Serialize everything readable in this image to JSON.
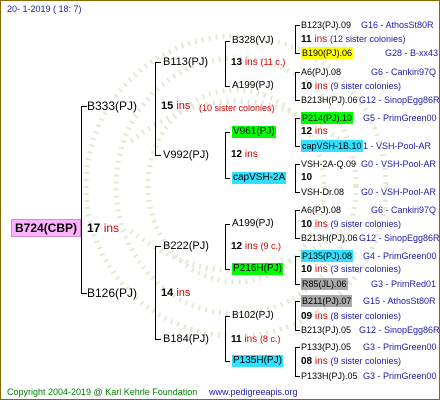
{
  "header": {
    "date": "20-   1-2019 ( 18:   7)"
  },
  "footer": {
    "copyright": "Copyright 2004-2019 @ Karl Kehrle Foundation",
    "site": "www.pedigreeapis.org"
  },
  "colors": {
    "pink": "#ffb0ff",
    "yellow": "#ffff00",
    "lime": "#00ff00",
    "cyan": "#2fe0ff",
    "grey": "#a9a9a9",
    "text_red": "#d40000",
    "text_navy": "#1a1aa8",
    "text_green": "#008000"
  },
  "tree": {
    "root": {
      "name": "B724(CBP)",
      "ins": "17",
      "ins_label": "ins"
    },
    "g1": [
      {
        "name": "B333(PJ)",
        "ins": "15",
        "ins_label": "ins",
        "note": "(10 sister colonies)"
      },
      {
        "name": "B126(PJ)",
        "ins": "14",
        "ins_label": "ins"
      }
    ],
    "g2": [
      {
        "name": "B113(PJ)",
        "ins": "13",
        "ins_label": "ins",
        "note": "(11 c.)"
      },
      {
        "name": "V992(PJ)",
        "ins": "12",
        "ins_label": "ins"
      },
      {
        "name": "B222(PJ)",
        "ins": "12",
        "ins_label": "ins",
        "note": "(9 c.)"
      },
      {
        "name": "B184(PJ)",
        "ins": "11",
        "ins_label": "ins",
        "note": "(8 c.)"
      }
    ],
    "g3": [
      {
        "name": "B328(VJ)",
        "ins": "11",
        "ins_label": "ins",
        "note": "(12 sister colonies)"
      },
      {
        "name": "A199(PJ)",
        "ins": "10",
        "ins_label": "ins",
        "note": "(9 sister colonies)"
      },
      {
        "name": "V961(PJ)",
        "ins": "12",
        "ins_label": "ins"
      },
      {
        "name": "capVSH-2A",
        "ins": "10",
        "ins_label": ""
      },
      {
        "name": "A199(PJ)",
        "ins": "10",
        "ins_label": "ins",
        "note": "(9 sister colonies)"
      },
      {
        "name": "P216H(PJ)",
        "ins": "10",
        "ins_label": "ins",
        "note": "(3 sister colonies)"
      },
      {
        "name": "B102(PJ)",
        "ins": "09",
        "ins_label": "ins",
        "note": "(8 sister colonies)"
      },
      {
        "name": "P135H(PJ)",
        "ins": "08",
        "ins_label": "ins",
        "note": "(9 sister colonies)"
      }
    ],
    "g4": [
      {
        "name": "B123(PJ).09",
        "info": "G16 - AthosSt80R"
      },
      {
        "name": "B190(PJ).06",
        "info": "G28 - B-xx43"
      },
      {
        "name": "A6(PJ).08",
        "info": "G6 - Cankiri97Q"
      },
      {
        "name": "B213H(PJ).06",
        "info": "G12 - SinopEgg86R"
      },
      {
        "name": "P214(PJ).10",
        "info": "G5 - PrimGreen00"
      },
      {
        "name": "capVSH-1B.10",
        "info": "1 - VSH-Pool-AR"
      },
      {
        "name": "VSH-2A-Q.09",
        "info": "G0 - VSH-Pool-AR"
      },
      {
        "name": "VSH-Dr.08",
        "info": "G0 - VSH-Pool-AR"
      },
      {
        "name": "A6(PJ).08",
        "info": "G6 - Cankiri97Q"
      },
      {
        "name": "B213H(PJ).06",
        "info": "G12 - SinopEgg86R"
      },
      {
        "name": "P135(PJ).08",
        "info": "G4 - PrimGreen00"
      },
      {
        "name": "R85(JL).06",
        "info": "G3 - PrimRed01"
      },
      {
        "name": "B211(PJ).07",
        "info": "G15 - AthosSt80R"
      },
      {
        "name": "B213(PJ).05",
        "info": "G12 - SinopEgg86R"
      },
      {
        "name": "P133(PJ).05",
        "info": "G3 - PrimGreen00"
      },
      {
        "name": "P133H(PJ).05",
        "info": "G3 - PrimGreen00"
      }
    ]
  }
}
